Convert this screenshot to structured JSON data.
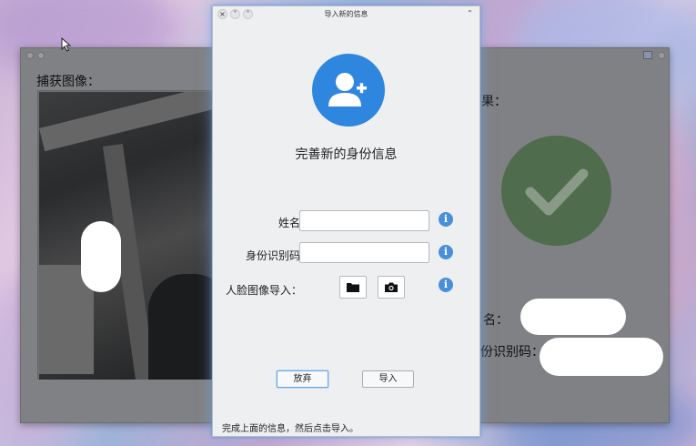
{
  "background_window": {
    "capture_label": "捕获图像：",
    "result_label": "结果：",
    "name_label": "名：",
    "id_label": "份识别码："
  },
  "dialog": {
    "title": "导入新的信息",
    "titlebar_buttons": [
      "×",
      "˅",
      "˄"
    ],
    "keep_above_button": "⌃",
    "heading": "完善新的身份信息",
    "name_label": "姓名：",
    "name_value": "",
    "id_label": "身份识别码：",
    "id_value": "",
    "face_label": "人脸图像导入：",
    "info_glyph": "i",
    "discard_button": "放弃",
    "import_button": "导入",
    "status_text": "完成上面的信息，然后点击导入。"
  },
  "colors": {
    "avatar": "#2e86de",
    "info": "#4a90d9",
    "result_ok": "#4f6c4d"
  },
  "icons": [
    "add-user-icon",
    "info-icon",
    "folder-icon",
    "camera-icon",
    "checkmark-icon",
    "mouse-pointer-icon"
  ]
}
